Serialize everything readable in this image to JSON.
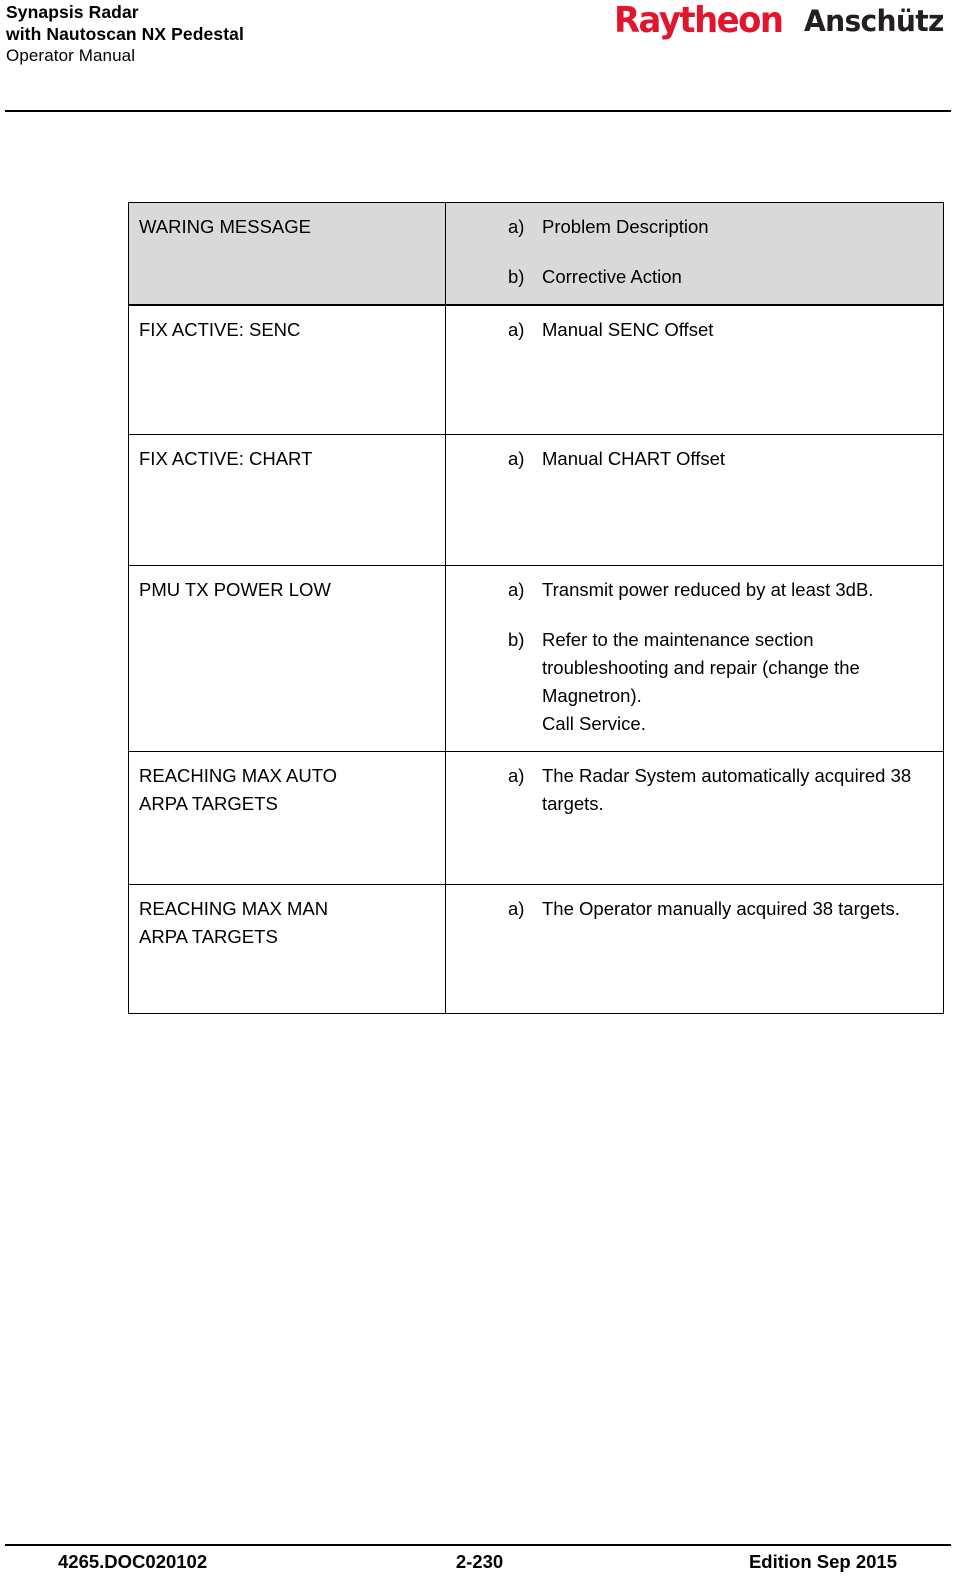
{
  "header": {
    "title_lines": [
      "Synapsis Radar",
      "with Nautoscan NX Pedestal",
      "Operator Manual"
    ],
    "brand": {
      "primary": "Raytheon",
      "secondary": "Anschütz",
      "primary_color": "#e2152c",
      "secondary_color": "#231f20"
    }
  },
  "table": {
    "header": {
      "message": "WARING MESSAGE",
      "items": [
        {
          "marker": "a)",
          "text": "Problem Description"
        },
        {
          "marker": "b)",
          "text": "Corrective Action"
        }
      ]
    },
    "rows": [
      {
        "message_lines": [
          "FIX ACTIVE: SENC"
        ],
        "items": [
          {
            "marker": "a)",
            "lines": [
              "Manual SENC Offset"
            ]
          }
        ]
      },
      {
        "message_lines": [
          "FIX ACTIVE: CHART"
        ],
        "items": [
          {
            "marker": "a)",
            "lines": [
              "Manual CHART Offset"
            ]
          }
        ]
      },
      {
        "message_lines": [
          "PMU TX POWER LOW"
        ],
        "items": [
          {
            "marker": "a)",
            "lines": [
              "Transmit power reduced by at least 3dB."
            ]
          },
          {
            "marker": "b)",
            "lines": [
              "Refer to the maintenance section troubleshooting and repair (change the Magnetron).",
              "Call Service."
            ]
          }
        ]
      },
      {
        "message_lines": [
          "REACHING MAX AUTO",
          "ARPA TARGETS"
        ],
        "items": [
          {
            "marker": "a)",
            "lines": [
              "The Radar System automatically acquired 38 targets."
            ]
          }
        ]
      },
      {
        "message_lines": [
          "REACHING MAX MAN",
          "ARPA TARGETS"
        ],
        "items": [
          {
            "marker": "a)",
            "lines": [
              "The Operator manually acquired 38 targets."
            ]
          }
        ]
      }
    ]
  },
  "footer": {
    "document_number": "4265.DOC020102",
    "page_number": "2-230",
    "edition": "Edition Sep 2015"
  }
}
